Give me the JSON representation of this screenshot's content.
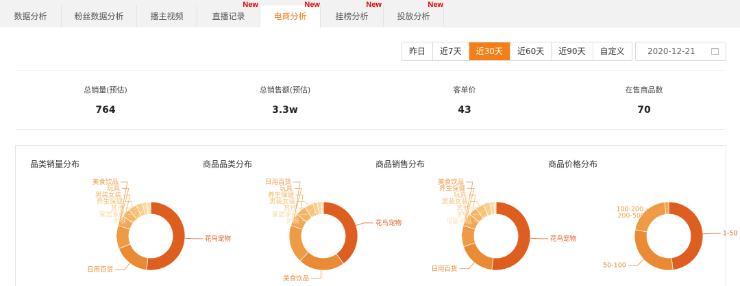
{
  "tabs": [
    {
      "label": "数据分析",
      "badge": ""
    },
    {
      "label": "粉丝数据分析",
      "badge": ""
    },
    {
      "label": "播主视频",
      "badge": ""
    },
    {
      "label": "直播记录",
      "badge": "New"
    },
    {
      "label": "电商分析",
      "badge": "New"
    },
    {
      "label": "挂榜分析",
      "badge": "New"
    },
    {
      "label": "投放分析",
      "badge": "New"
    }
  ],
  "range_options": [
    "昨日",
    "近7天",
    "近30天",
    "近60天",
    "近90天",
    "自定义"
  ],
  "selected_range": "近30天",
  "date_value": "2020-12-21",
  "stats": [
    {
      "label": "总销量(预估)",
      "value": "764"
    },
    {
      "label": "总销售额(预估)",
      "value": "3.3w"
    },
    {
      "label": "客单价",
      "value": "43"
    },
    {
      "label": "在售商品数",
      "value": "70"
    }
  ],
  "colors": {
    "accent": "#f57f17",
    "badge": "#e00000"
  },
  "chart_data": [
    {
      "type": "pie",
      "title": "品类销量分布",
      "categories": [
        "花鸟宠物",
        "日用百货",
        "美食饮品",
        "玩具",
        "男装女装",
        "养生保健",
        "其他",
        "家居家纺",
        "护肤"
      ],
      "values": [
        52,
        17,
        11,
        5,
        4,
        4,
        3,
        2,
        2
      ]
    },
    {
      "type": "pie",
      "title": "商品品类分布",
      "categories": [
        "花鸟宠物",
        "美食饮品",
        "日用百货",
        "玩具",
        "养生保健",
        "男装女装",
        "其他",
        "家居家纺",
        "护肤"
      ],
      "values": [
        40,
        22,
        18,
        6,
        5,
        4,
        2,
        2,
        1
      ]
    },
    {
      "type": "pie",
      "title": "商品销售分布",
      "categories": [
        "花鸟宠物",
        "日用百货",
        "美食饮品",
        "养生保健",
        "玩具",
        "男装女装",
        "其他",
        "护肤",
        "母婴用品"
      ],
      "values": [
        52,
        18,
        10,
        6,
        4,
        4,
        3,
        2,
        1
      ]
    },
    {
      "type": "pie",
      "title": "商品价格分布",
      "categories": [
        "1-50",
        "50-100",
        "100-200",
        "200-500"
      ],
      "values": [
        48,
        30,
        20,
        2
      ]
    }
  ]
}
